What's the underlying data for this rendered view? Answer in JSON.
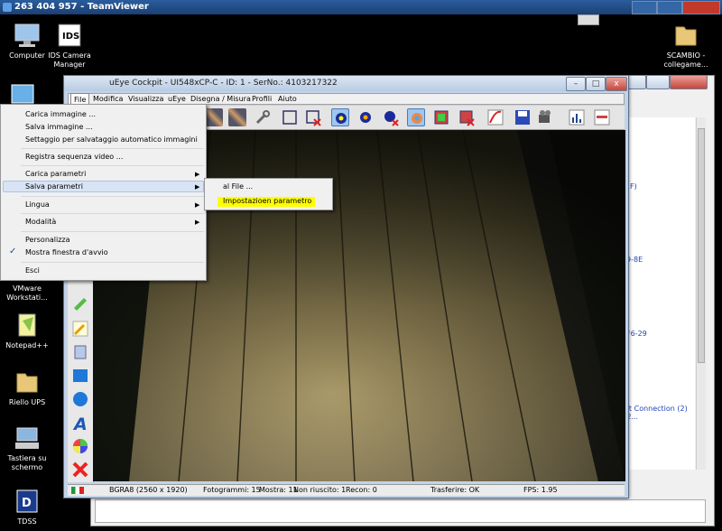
{
  "teamviewer": {
    "title": "263 404 957 - TeamViewer"
  },
  "desktop": {
    "icons": [
      {
        "label": "Computer"
      },
      {
        "label": "IDS Camera Manager"
      },
      {
        "label": "SCAMBIO - collegame..."
      },
      {
        "label": "VMware Workstati..."
      },
      {
        "label": "Notepad++"
      },
      {
        "label": "Riello UPS"
      },
      {
        "label": "Tastiera su schermo"
      },
      {
        "label": "TDSS"
      }
    ]
  },
  "background_window": {
    "links": [
      "F)",
      "9-8E",
      "F6-29",
      "et Connection (2) I2..."
    ]
  },
  "ueye": {
    "title": "uEye Cockpit - UI548xCP-C - ID: 1 - SerNo.: 4103217322",
    "window_controls": {
      "minimize": "–",
      "maximize": "□",
      "close": "x"
    },
    "menubar": [
      "File",
      "Modifica",
      "Visualizza",
      "uEye",
      "Disegna / Misura",
      "Profili",
      "Aiuto"
    ],
    "status": {
      "format": "BGRA8 (2560 x 1920)",
      "frames": "Fotogrammi: 15",
      "shown": "Mostra: 11",
      "failed": "Non riuscito: 1",
      "recon": "Recon: 0",
      "transfer": "Trasferire: OK",
      "fps": "FPS: 1.95"
    }
  },
  "file_menu": {
    "items": [
      {
        "label": "Carica immagine ..."
      },
      {
        "label": "Salva immagine ..."
      },
      {
        "label": "Settaggio per salvataggio automatico immagini"
      },
      {
        "label": "Registra sequenza video ..."
      },
      {
        "label": "Carica parametri"
      },
      {
        "label": "Salva parametri"
      },
      {
        "label": "Lingua"
      },
      {
        "label": "Modalità"
      },
      {
        "label": "Personalizza"
      },
      {
        "label": "Mostra finestra d'avvio"
      },
      {
        "label": "Esci"
      }
    ],
    "checkmark": "✓",
    "arrow": "▶"
  },
  "submenu": {
    "items": [
      {
        "label": "al File ..."
      },
      {
        "label": "Impostazioen parametro"
      }
    ]
  },
  "colors": {
    "highlight": "#ffff00",
    "menu_hover": "#d8e4f5",
    "window_frame": "#c2d3e8"
  }
}
